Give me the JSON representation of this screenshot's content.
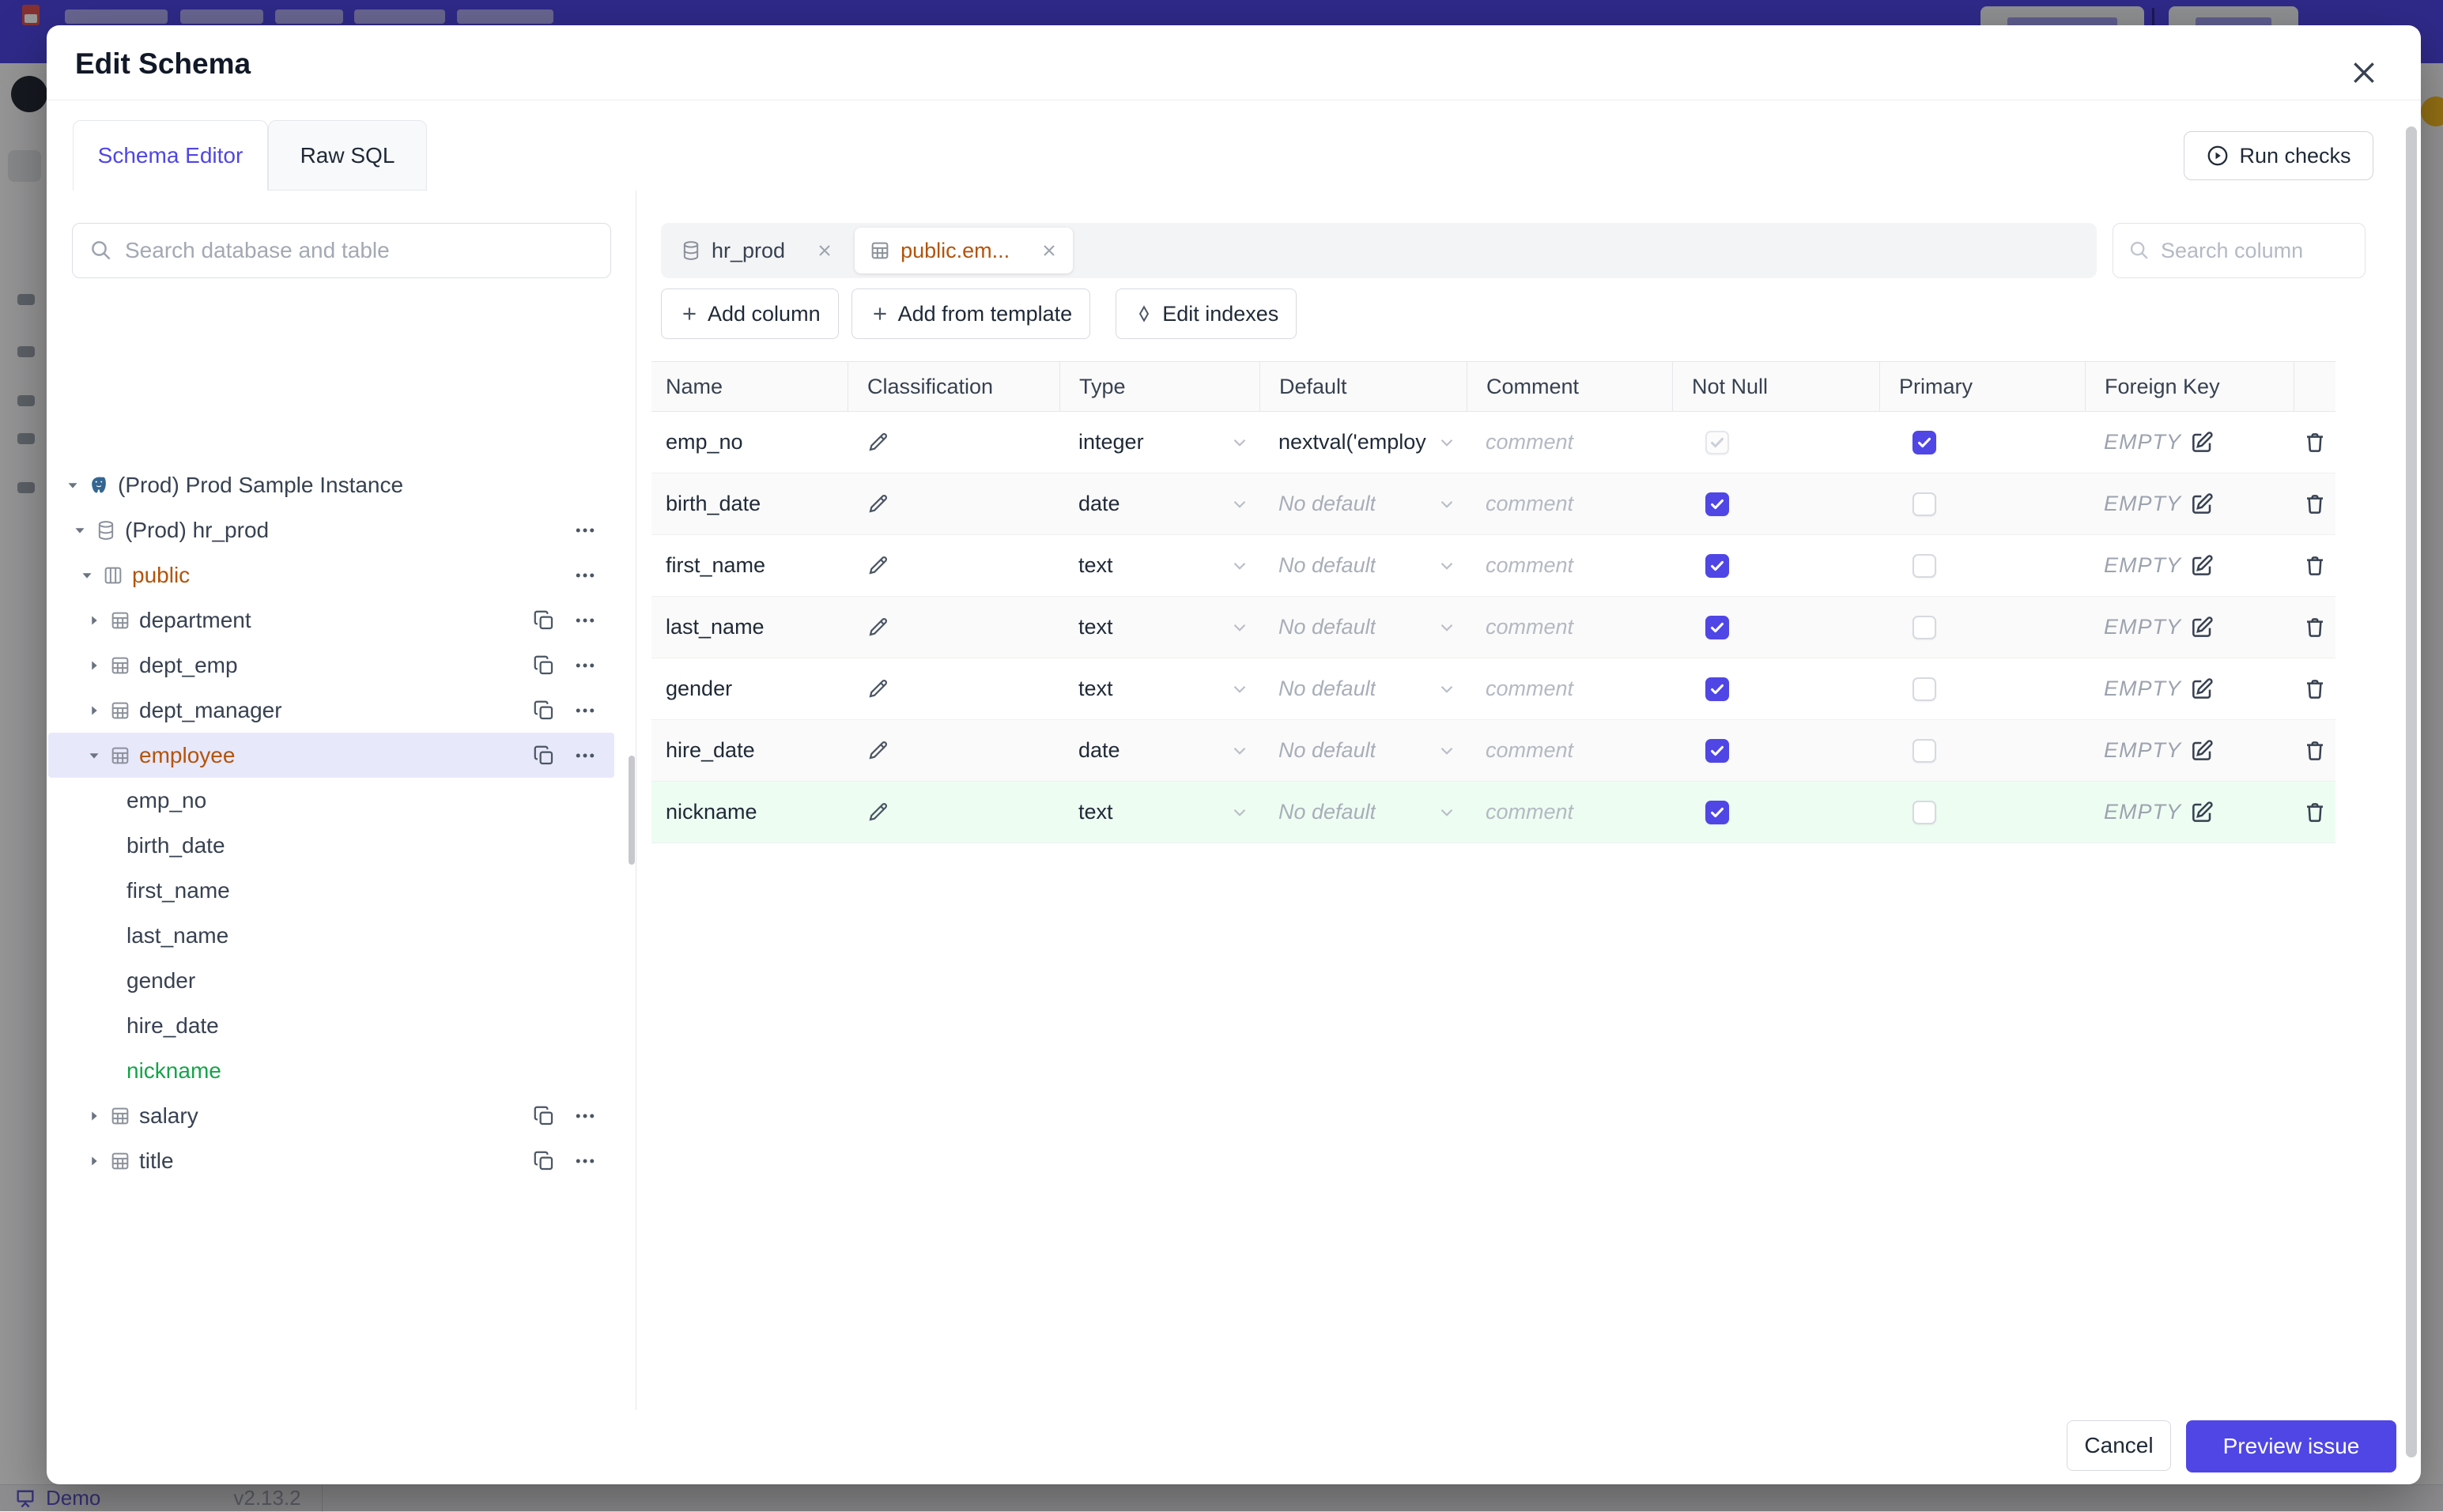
{
  "page": {
    "footer": {
      "demo": "Demo",
      "version": "v2.13.2"
    }
  },
  "modal": {
    "title": "Edit Schema",
    "run_checks": "Run checks",
    "tabs": {
      "editor": "Schema Editor",
      "raw_sql": "Raw SQL"
    },
    "sidebar": {
      "search_placeholder": "Search database and table",
      "tree": [
        {
          "label": "(Prod) Prod Sample Instance",
          "icon": "postgres",
          "level": 0,
          "caret": "down"
        },
        {
          "label": "(Prod) hr_prod",
          "icon": "database",
          "level": 1,
          "caret": "down",
          "actions": [
            "more"
          ]
        },
        {
          "label": "public",
          "icon": "schema",
          "level": 2,
          "caret": "down",
          "highlight": "amber",
          "actions": [
            "more"
          ]
        },
        {
          "label": "department",
          "icon": "table",
          "level": 3,
          "caret": "right",
          "actions": [
            "copy",
            "more"
          ]
        },
        {
          "label": "dept_emp",
          "icon": "table",
          "level": 3,
          "caret": "right",
          "actions": [
            "copy",
            "more"
          ]
        },
        {
          "label": "dept_manager",
          "icon": "table",
          "level": 3,
          "caret": "right",
          "actions": [
            "copy",
            "more"
          ]
        },
        {
          "label": "employee",
          "icon": "table",
          "level": 3,
          "caret": "down",
          "highlight": "amber",
          "selected": true,
          "actions": [
            "copy",
            "more"
          ]
        },
        {
          "label": "emp_no",
          "column": true
        },
        {
          "label": "birth_date",
          "column": true
        },
        {
          "label": "first_name",
          "column": true
        },
        {
          "label": "last_name",
          "column": true
        },
        {
          "label": "gender",
          "column": true
        },
        {
          "label": "hire_date",
          "column": true
        },
        {
          "label": "nickname",
          "column": true,
          "highlight": "green"
        },
        {
          "label": "salary",
          "icon": "table",
          "level": 3,
          "caret": "right",
          "actions": [
            "copy",
            "more"
          ]
        },
        {
          "label": "title",
          "icon": "table",
          "level": 3,
          "caret": "right",
          "actions": [
            "copy",
            "more"
          ]
        }
      ]
    },
    "editor": {
      "chips": [
        {
          "label": "hr_prod",
          "icon": "database",
          "active": false
        },
        {
          "label": "public.em...",
          "icon": "table",
          "active": true
        }
      ],
      "column_search_placeholder": "Search column",
      "toolbar": [
        {
          "label": "Add column",
          "icon": "plus"
        },
        {
          "label": "Add from template",
          "icon": "plus"
        },
        {
          "label": "Edit indexes",
          "icon": "diamond"
        }
      ],
      "table": {
        "headers": [
          "Name",
          "Classification",
          "Type",
          "Default",
          "Comment",
          "Not Null",
          "Primary",
          "Foreign Key"
        ],
        "comment_placeholder": "comment",
        "foreign_key_empty": "EMPTY",
        "rows": [
          {
            "name": "emp_no",
            "type": "integer",
            "default": "nextval('employ",
            "default_is_value": true,
            "not_null": true,
            "not_null_disabled": true,
            "primary": true,
            "highlight": false
          },
          {
            "name": "birth_date",
            "type": "date",
            "default": "No default",
            "default_is_value": false,
            "not_null": true,
            "not_null_disabled": false,
            "primary": false,
            "highlight": false
          },
          {
            "name": "first_name",
            "type": "text",
            "default": "No default",
            "default_is_value": false,
            "not_null": true,
            "not_null_disabled": false,
            "primary": false,
            "highlight": false
          },
          {
            "name": "last_name",
            "type": "text",
            "default": "No default",
            "default_is_value": false,
            "not_null": true,
            "not_null_disabled": false,
            "primary": false,
            "highlight": false
          },
          {
            "name": "gender",
            "type": "text",
            "default": "No default",
            "default_is_value": false,
            "not_null": true,
            "not_null_disabled": false,
            "primary": false,
            "highlight": false
          },
          {
            "name": "hire_date",
            "type": "date",
            "default": "No default",
            "default_is_value": false,
            "not_null": true,
            "not_null_disabled": false,
            "primary": false,
            "highlight": false
          },
          {
            "name": "nickname",
            "type": "text",
            "default": "No default",
            "default_is_value": false,
            "not_null": true,
            "not_null_disabled": false,
            "primary": false,
            "highlight": true
          }
        ]
      }
    },
    "footer": {
      "cancel": "Cancel",
      "submit": "Preview issue"
    }
  },
  "colors": {
    "accent": "#4f46e5",
    "amber": "#b45309",
    "green": "#16a34a",
    "header_bar": "#4f46e5",
    "new_row_bg": "#edfdf2",
    "selected_tree_bg": "#e8e8fb"
  }
}
